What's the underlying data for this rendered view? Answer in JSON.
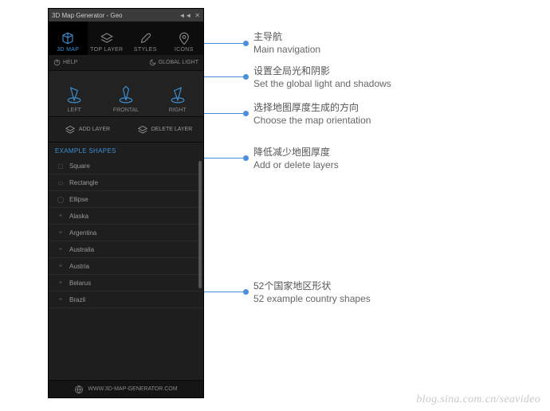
{
  "window": {
    "title": "3D Map Generator - Geo"
  },
  "tabs": {
    "map": "3D MAP",
    "top": "TOP LAYER",
    "styles": "STYLES",
    "icons": "ICONS"
  },
  "subbar": {
    "help": "HELP",
    "global_light": "GLOBAL LIGHT"
  },
  "orient": {
    "left": "LEFT",
    "frontal": "FRONTAL",
    "right": "RIGHT"
  },
  "layers": {
    "add": "ADD LAYER",
    "del": "DELETE LAYER"
  },
  "section_header": "EXAMPLE SHAPES",
  "shapes": [
    "Square",
    "Rectangle",
    "Ellipse",
    "Alaska",
    "Argentina",
    "Australia",
    "Austria",
    "Belarus",
    "Brazil"
  ],
  "footer": {
    "url": "WWW.3D-MAP-GENERATOR.COM"
  },
  "annotations": {
    "nav": {
      "zh": "主导航",
      "en": "Main navigation"
    },
    "light": {
      "zh": "设置全局光和阴影",
      "en": "Set the global light and shadows"
    },
    "orient": {
      "zh": "选择地图厚度生成的方向",
      "en": "Choose the map orientation"
    },
    "layers": {
      "zh": "降低减少地图厚度",
      "en": "Add or delete layers"
    },
    "shapes": {
      "zh": "52个国家地区形状",
      "en": "52 example country shapes"
    }
  },
  "watermark": "blog.sina.com.cn/seavideo"
}
